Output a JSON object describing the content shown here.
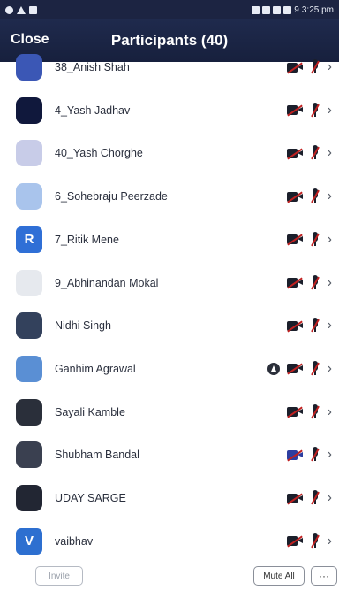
{
  "status_bar": {
    "left_icons": [
      "alert-icon",
      "warning-icon",
      "message-icon"
    ],
    "time": "3:25 pm",
    "battery": "9"
  },
  "header": {
    "close_label": "Close",
    "title": "Participants (40)"
  },
  "participants": [
    {
      "name": "38_Anish Shah",
      "avatar": {
        "type": "image",
        "color": "#3b57b5",
        "letter": ""
      },
      "video": "off",
      "mic": "muted",
      "sharing": false
    },
    {
      "name": "4_Yash Jadhav",
      "avatar": {
        "type": "image",
        "color": "#10183c",
        "letter": ""
      },
      "video": "off",
      "mic": "muted",
      "sharing": false
    },
    {
      "name": "40_Yash Chorghe",
      "avatar": {
        "type": "image",
        "color": "#c8cce8",
        "letter": ""
      },
      "video": "off",
      "mic": "muted",
      "sharing": false
    },
    {
      "name": "6_Sohebraju Peerzade",
      "avatar": {
        "type": "image",
        "color": "#a9c4ec",
        "letter": ""
      },
      "video": "off",
      "mic": "muted",
      "sharing": false
    },
    {
      "name": "7_Ritik Mene",
      "avatar": {
        "type": "letter",
        "color": "#2f6fd6",
        "letter": "R"
      },
      "video": "off",
      "mic": "muted",
      "sharing": false
    },
    {
      "name": "9_Abhinandan Mokal",
      "avatar": {
        "type": "image",
        "color": "#e6e9ee",
        "letter": ""
      },
      "video": "off",
      "mic": "muted",
      "sharing": false
    },
    {
      "name": "Nidhi Singh",
      "avatar": {
        "type": "image",
        "color": "#33415c",
        "letter": ""
      },
      "video": "off",
      "mic": "muted",
      "sharing": false
    },
    {
      "name": "Ganhim Agrawal",
      "avatar": {
        "type": "image",
        "color": "#5a8fd4",
        "letter": ""
      },
      "video": "off",
      "mic": "muted",
      "sharing": true
    },
    {
      "name": "Sayali Kamble",
      "avatar": {
        "type": "image",
        "color": "#2a2f3a",
        "letter": ""
      },
      "video": "off",
      "mic": "muted",
      "sharing": false
    },
    {
      "name": "Shubham Bandal",
      "avatar": {
        "type": "image",
        "color": "#3a4050",
        "letter": ""
      },
      "video": "off-blue",
      "mic": "muted",
      "sharing": false
    },
    {
      "name": "UDAY SARGE",
      "avatar": {
        "type": "image",
        "color": "#222633",
        "letter": ""
      },
      "video": "off",
      "mic": "muted",
      "sharing": false
    },
    {
      "name": "vaibhav",
      "avatar": {
        "type": "letter",
        "color": "#2d6fd0",
        "letter": "V"
      },
      "video": "off",
      "mic": "muted",
      "sharing": false
    }
  ],
  "bottom_bar": {
    "invite_label": "Invite",
    "mute_all_label": "Mute All",
    "more_label": "···"
  },
  "colors": {
    "header_bg": "#1f2a4d",
    "muted_red": "#c02020"
  }
}
